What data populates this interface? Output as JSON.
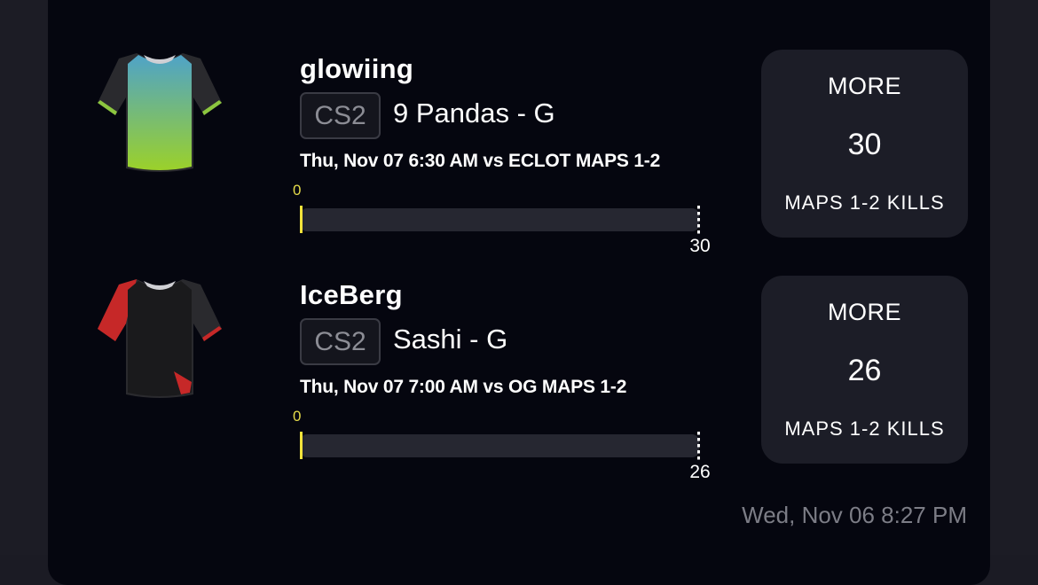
{
  "picks": [
    {
      "player": "glowiing",
      "game": "CS2",
      "team_position": "9 Pandas - G",
      "match_info": "Thu, Nov 07 6:30 AM  vs ECLOT MAPS 1-2",
      "progress_start": "0",
      "progress_target": "30",
      "progress_fraction": 0,
      "prop": {
        "direction": "MORE",
        "line": "30",
        "stat": "MAPS 1-2 KILLS"
      },
      "jersey_icon": "green-blue-jersey-icon",
      "colors": {
        "body_top": "#4fa3c8",
        "body_bottom": "#9bd12a",
        "sleeve": "#2a2a2e",
        "trim": "#8cc63f"
      }
    },
    {
      "player": "IceBerg",
      "game": "CS2",
      "team_position": "Sashi - G",
      "match_info": "Thu, Nov 07 7:00 AM  vs OG MAPS 1-2",
      "progress_start": "0",
      "progress_target": "26",
      "progress_fraction": 0,
      "prop": {
        "direction": "MORE",
        "line": "26",
        "stat": "MAPS 1-2 KILLS"
      },
      "jersey_icon": "black-red-jersey-icon",
      "colors": {
        "body_top": "#1a1a1c",
        "body_bottom": "#1a1a1c",
        "sleeve": "#2a2a2e",
        "trim": "#c62828"
      }
    }
  ],
  "timestamp": "Wed, Nov 06 8:27 PM",
  "colors": {
    "background": "#05060f",
    "panel": "#1c1d27",
    "accent": "#f2e33b"
  }
}
